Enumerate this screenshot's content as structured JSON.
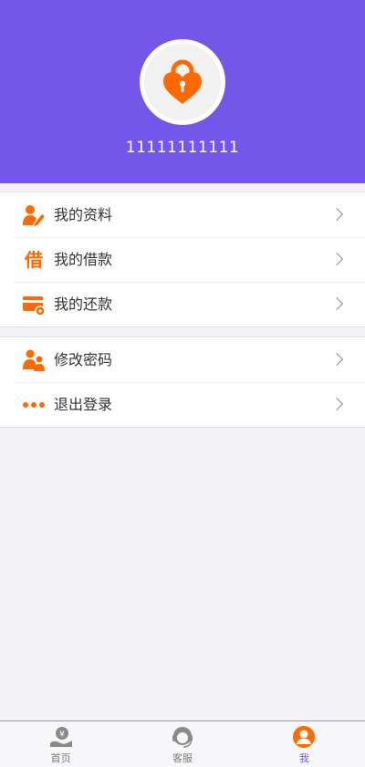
{
  "profile": {
    "phone": "11111111111"
  },
  "menu_group_1": [
    {
      "label": "我的资料",
      "icon": "user-edit-icon"
    },
    {
      "label": "我的借款",
      "icon": "borrow-icon"
    },
    {
      "label": "我的还款",
      "icon": "card-icon"
    }
  ],
  "menu_group_2": [
    {
      "label": "修改密码",
      "icon": "users-icon"
    },
    {
      "label": "退出登录",
      "icon": "more-dots-icon"
    }
  ],
  "borrow_icon_char": "借",
  "tabs": [
    {
      "label": "首页",
      "icon": "home-money-icon"
    },
    {
      "label": "客服",
      "icon": "service-icon"
    },
    {
      "label": "我",
      "icon": "profile-icon"
    }
  ],
  "colors": {
    "header": "#7356ea",
    "accent": "#ff6a00",
    "tab_active": "#7356ea"
  }
}
